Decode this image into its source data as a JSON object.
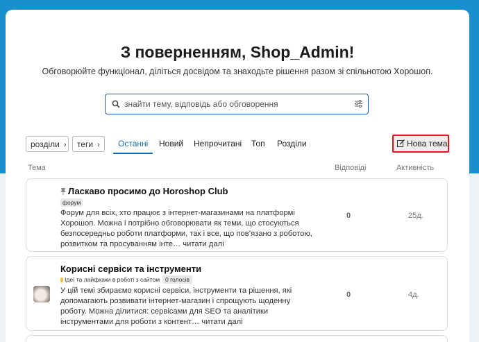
{
  "header": {
    "title": "З поверненням, Shop_Admin!",
    "subtitle": "Обговорюйте функціонал, діліться досвідом та знаходьте рішення разом зі спільнотою Хорошоп."
  },
  "search": {
    "placeholder": "знайти тему, відповідь або обговорення"
  },
  "nav": {
    "dropdown_sections": "розділи",
    "dropdown_tags": "теги",
    "tabs": [
      "Останні",
      "Новий",
      "Непрочитані",
      "Топ",
      "Розділи"
    ],
    "new_topic": "Нова тема"
  },
  "columns": {
    "topic": "Тема",
    "replies": "Відповіді",
    "activity": "Активність"
  },
  "topics": [
    {
      "title": "Ласкаво просимо до Horoshop Club",
      "tag": "форум",
      "excerpt": "Форум для всіх, хто працює з інтернет-магазинами на платформі Хорошоп. Можна і потрібно обговорювати як теми, що стосуються безпосередньо роботи платформи, так і все, що пов’язано з роботою, розвитком та просуванням інте… читати далі",
      "replies": "0",
      "activity": "25д."
    },
    {
      "title": "Корисні сервіси та інструменти",
      "category": "Ідеї та лайфхаки в роботі з сайтом",
      "votes": "0 голосів",
      "excerpt": "У цій темі збираємо корисні сервіси, інструменти та рішення, які допомагають розвивати інтернет-магазин і спрощують щоденну роботу. Можна ділитися: сервісами для SEO та аналітики інструментами для роботи з контент… читати далі",
      "replies": "0",
      "activity": "4д."
    }
  ]
}
